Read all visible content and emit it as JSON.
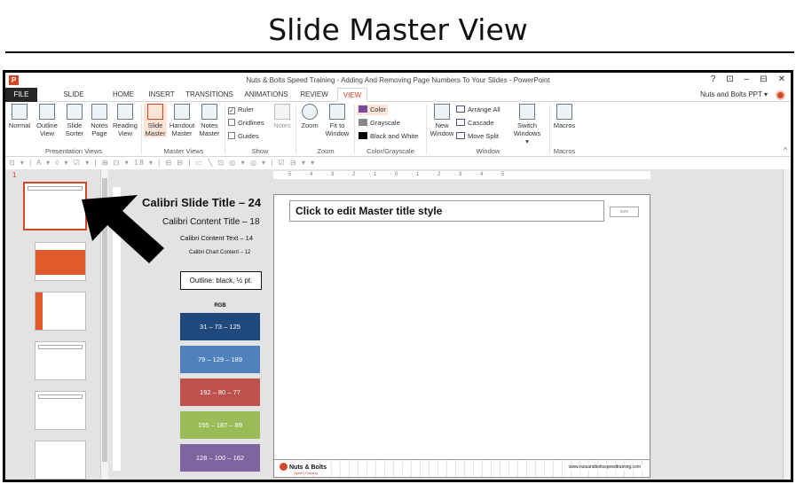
{
  "heading": "Slide Master View",
  "window": {
    "title": "Nuts & Bolts Speed Training - Adding And Removing Page Numbers To Your Slides - PowerPoint",
    "controls": [
      "?",
      "⊡",
      "–",
      "⊟",
      "✕"
    ],
    "account": "Nuts and Bolts PPT ▾"
  },
  "tabs": {
    "file": "FILE",
    "slide_master": "SLIDE MASTER",
    "home": "HOME",
    "insert": "INSERT",
    "transitions": "TRANSITIONS",
    "animations": "ANIMATIONS",
    "review": "REVIEW",
    "view": "VIEW"
  },
  "ribbon": {
    "normal": "Normal",
    "outline_view": "Outline View",
    "slide_sorter": "Slide Sorter",
    "notes_page": "Notes Page",
    "reading_view": "Reading View",
    "presentation_views": "Presentation Views",
    "slide_master": "Slide Master",
    "handout_master": "Handout Master",
    "notes_master": "Notes Master",
    "master_views": "Master Views",
    "ruler": "Ruler",
    "gridlines": "Gridlines",
    "guides": "Guides",
    "notes": "Notes",
    "show": "Show",
    "zoom": "Zoom",
    "fit_to_window": "Fit to Window",
    "zoom_group": "Zoom",
    "color": "Color",
    "grayscale": "Grayscale",
    "black_and_white": "Black and White",
    "color_group": "Color/Grayscale",
    "new_window": "New Window",
    "arrange_all": "Arrange All",
    "cascade": "Cascade",
    "move_split": "Move Split",
    "switch_windows": "Switch Windows ▾",
    "window_group": "Window",
    "macros": "Macros",
    "macros_group": "Macros",
    "ruler_checked": true,
    "gridlines_checked": false,
    "guides_checked": false
  },
  "qat": "⊡ ▾ | A ▾ ◊ ▾ ☑ ▾ | ⊞ ⊡ ▾ 18 ▾ | ⊟ ⊟ | ▭ ╲ ⊡ ◎ ▾ ◎ ▾ | ☑ ⊟ ▾ ▾",
  "thumbs": {
    "first_number": "1"
  },
  "ruler": "· · · 5 · · · 4 · · · 3 · · · 2 · · · 1 · · · 0 · · · 1 · · · 2 · · · 3 · · · 4 · · · 5",
  "slide": {
    "title": "Click to edit Master title style",
    "tag": "date",
    "logo_text": "Nuts & Bolts",
    "logo_sub": "Speed Training",
    "url": "www.nutsandboltsspeedtraining.com"
  },
  "annotations": {
    "title_font": "Calibri  Slide Title – 24",
    "content_title": "Calibri Content Title – 18",
    "content_text": "Calibri  Content  Text – 14",
    "chart_content": "Calibri  Chart  Content – 12",
    "outline": "Outline: black, ½ pt.",
    "rgb_label": "RGB",
    "swatches": [
      {
        "label": "31 – 73 – 125",
        "color": "#1f497d"
      },
      {
        "label": "79 – 129 – 189",
        "color": "#4f81bd"
      },
      {
        "label": "192 – 80 – 77",
        "color": "#c0504d"
      },
      {
        "label": "155 – 187 – 89",
        "color": "#9bbb59"
      },
      {
        "label": "128 – 100 – 162",
        "color": "#8064a2"
      }
    ]
  },
  "colors": {
    "accent": "#d24726"
  }
}
